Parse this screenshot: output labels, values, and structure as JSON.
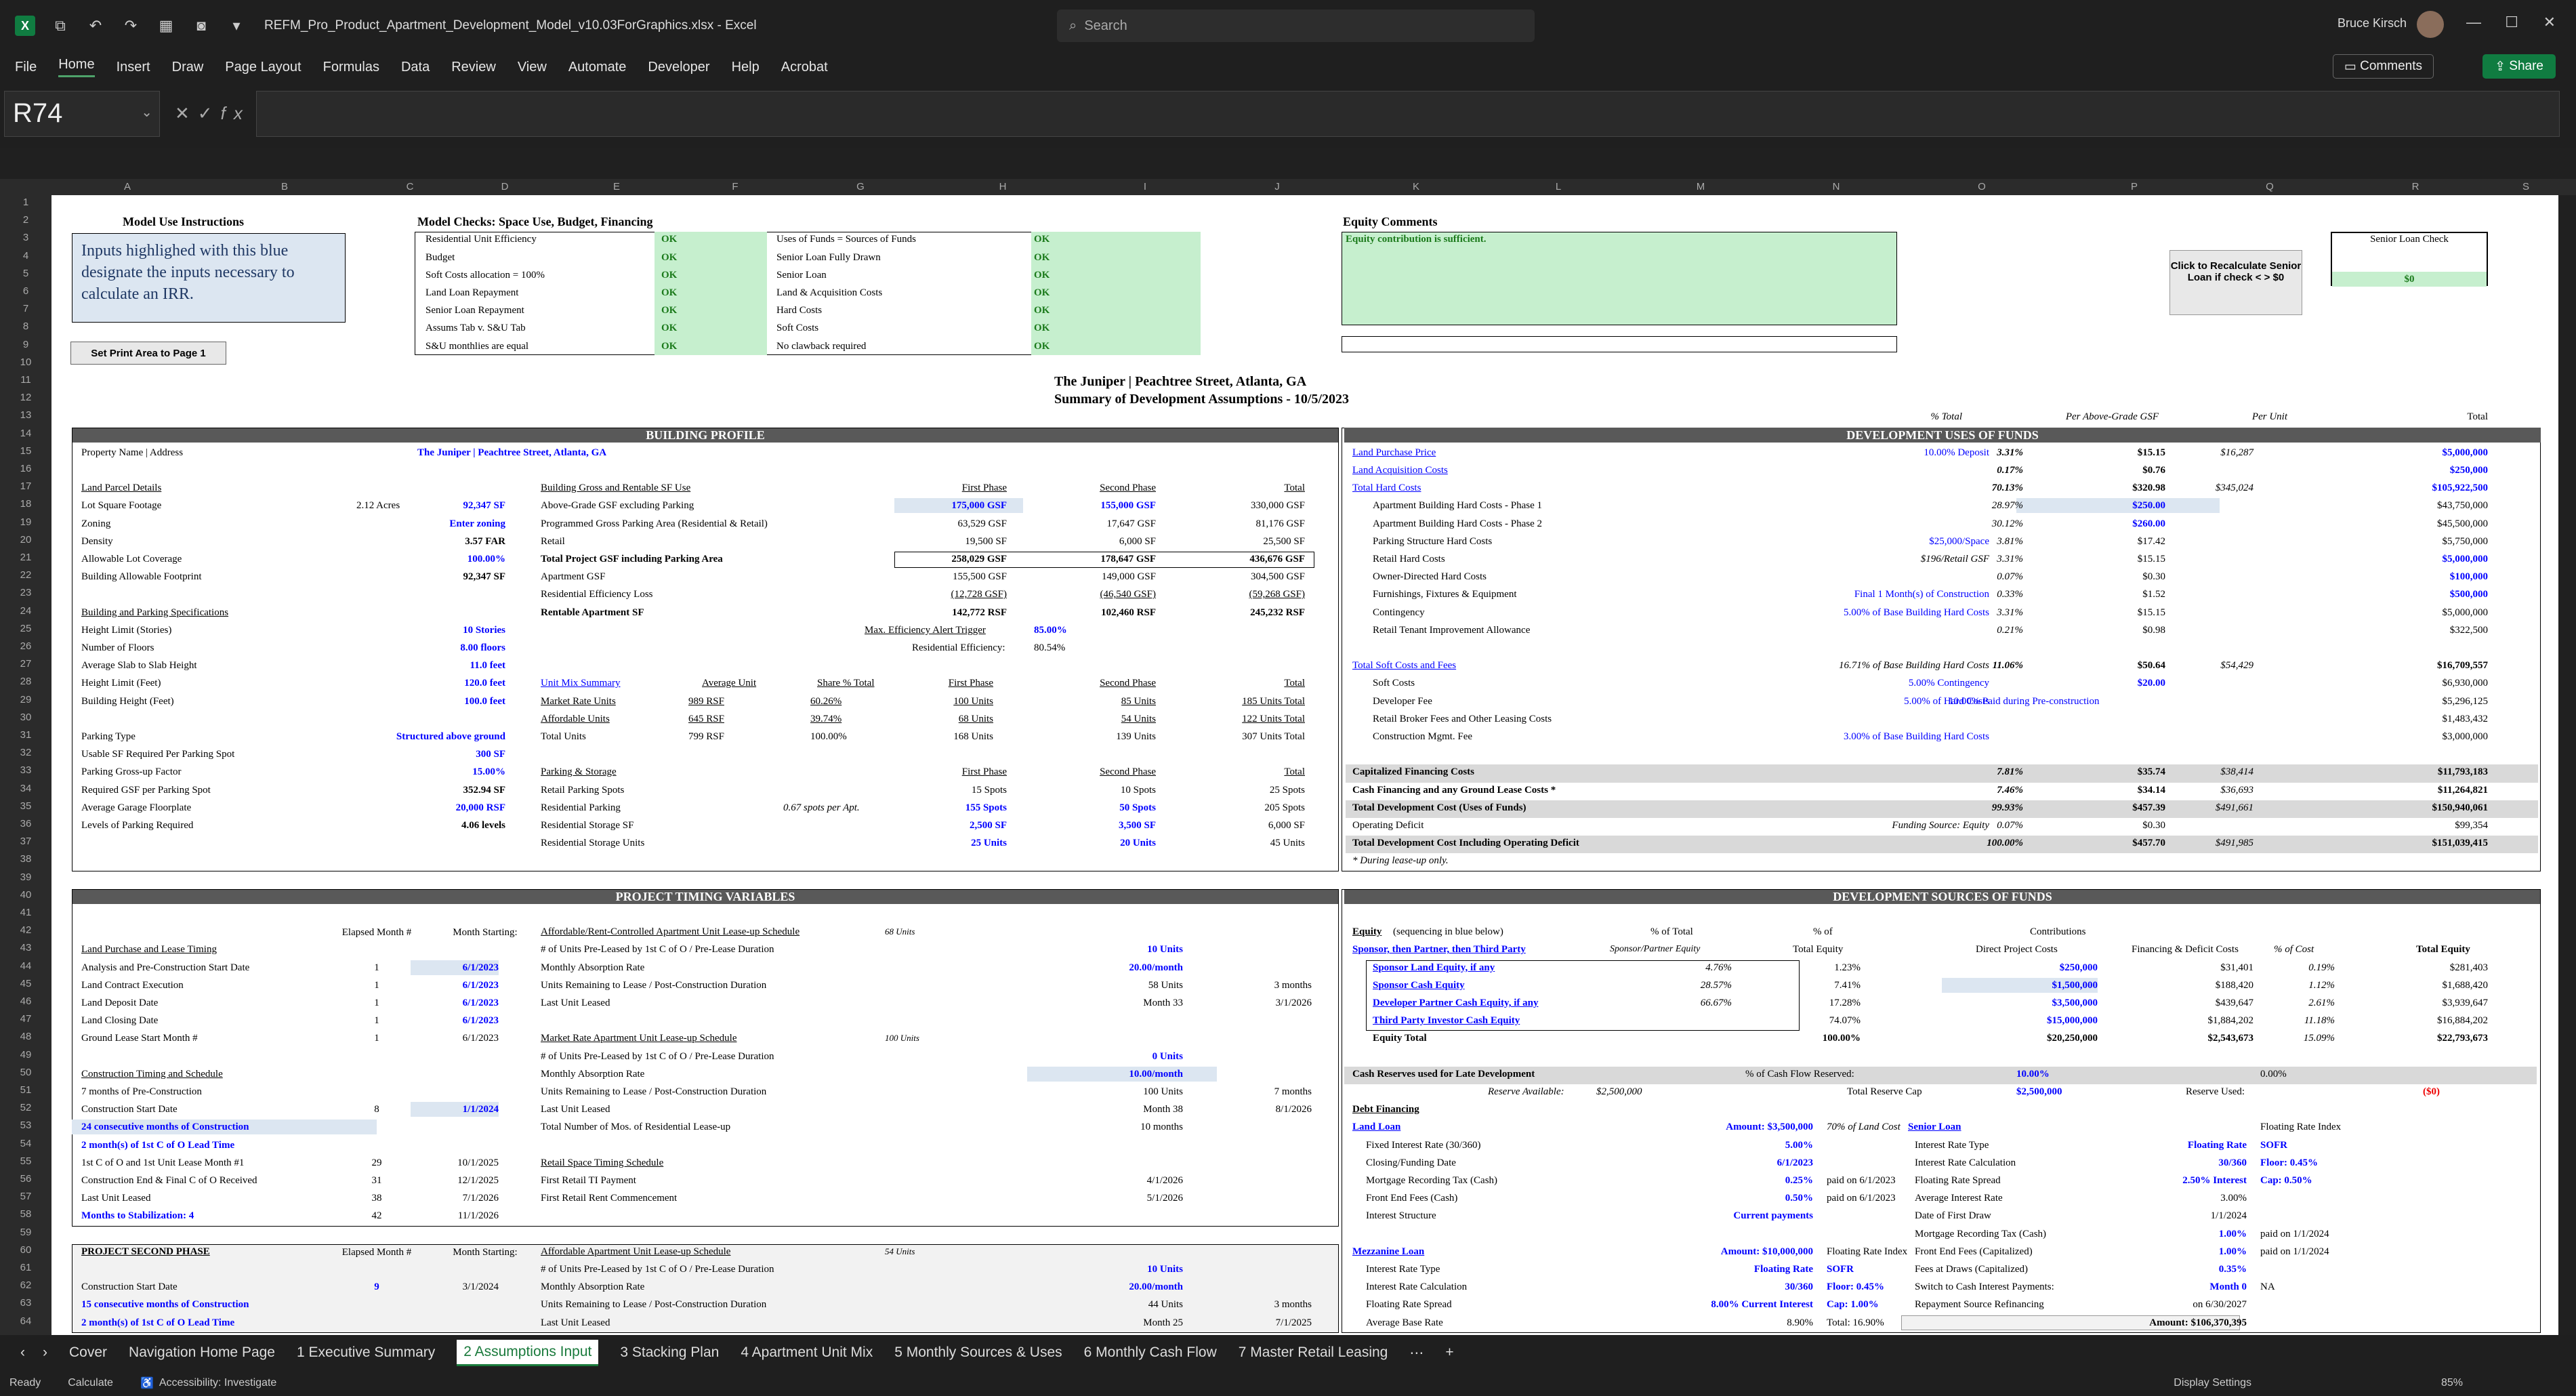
{
  "app": {
    "filename": "REFM_Pro_Product_Apartment_Development_Model_v10.03ForGraphics.xlsx",
    "app_name": "Excel",
    "search_placeholder": "Search",
    "user": "Bruce Kirsch"
  },
  "menu": [
    "File",
    "Home",
    "Insert",
    "Draw",
    "Page Layout",
    "Formulas",
    "Data",
    "Review",
    "View",
    "Automate",
    "Developer",
    "Help",
    "Acrobat"
  ],
  "buttons": {
    "comments": "Comments",
    "share": "Share"
  },
  "namebox": "R74",
  "columns": [
    "A",
    "B",
    "C",
    "D",
    "E",
    "F",
    "G",
    "H",
    "I",
    "J",
    "K",
    "L",
    "M",
    "N",
    "O",
    "P",
    "Q",
    "R",
    "S"
  ],
  "rows": [
    "1",
    "2",
    "3",
    "4",
    "5",
    "6",
    "7",
    "8",
    "9",
    "10",
    "11",
    "12",
    "13",
    "14",
    "15",
    "16",
    "17",
    "18",
    "19",
    "20",
    "21",
    "22",
    "23",
    "24",
    "25",
    "26",
    "27",
    "28",
    "29",
    "30",
    "31",
    "32",
    "33",
    "34",
    "35",
    "36",
    "37",
    "38",
    "39",
    "40",
    "41",
    "42",
    "43",
    "44",
    "45",
    "46",
    "47",
    "48",
    "49",
    "50",
    "51",
    "52",
    "53",
    "54",
    "55",
    "56",
    "57",
    "58",
    "59",
    "60",
    "61",
    "62",
    "63",
    "64"
  ],
  "sheet": {
    "model_use": "Model Use Instructions",
    "instructions": "Inputs highlighed with this blue designate the inputs necessary to calculate an IRR.",
    "print_btn": "Set Print Area to Page 1",
    "checks_title": "Model Checks: Space Use, Budget, Financing",
    "checks_left": [
      "Residential Unit Efficiency",
      "Budget",
      "Soft Costs allocation = 100%",
      "Land Loan Repayment",
      "Senior Loan Repayment",
      "Assums Tab v. S&U Tab",
      "S&U monthlies are equal"
    ],
    "checks_right": [
      "Uses of Funds = Sources of Funds",
      "Senior Loan Fully Drawn",
      "Senior Loan",
      "Land & Acquisition Costs",
      "Hard Costs",
      "Soft Costs",
      "No clawback required"
    ],
    "ok": "OK",
    "equity_comments_title": "Equity Comments",
    "equity_comments": "Equity contribution is sufficient.",
    "recalc_btn": "Click to Recalculate Senior Loan if check < > $0",
    "senior_check_title": "Senior Loan Check",
    "senior_check_value": "$0",
    "title1": "The Juniper | Peachtree Street, Atlanta, GA",
    "title2": "Summary of Development Assumptions - 10/5/2023",
    "bp_header": "BUILDING PROFILE",
    "uses_header": "DEVELOPMENT USES OF FUNDS",
    "uses_colhdrs": [
      "% Total",
      "Per Above-Grade GSF",
      "Per Unit",
      "Total"
    ],
    "property_label": "Property Name | Address",
    "property_value": "The Juniper | Peachtree Street, Atlanta, GA",
    "bp_rows": [
      [
        "Land Parcel Details",
        "",
        ""
      ],
      [
        "Lot Square Footage",
        "2.12 Acres",
        "92,347 SF"
      ],
      [
        "Zoning",
        "",
        "Enter zoning"
      ],
      [
        "Density",
        "",
        "3.57 FAR"
      ],
      [
        "Allowable Lot Coverage",
        "",
        "100.00%"
      ],
      [
        "Building Allowable Footprint",
        "",
        "92,347 SF"
      ],
      [
        "",
        "",
        ""
      ],
      [
        "Building and Parking Specifications",
        "",
        ""
      ],
      [
        "Height Limit (Stories)",
        "",
        "10 Stories"
      ],
      [
        "Number of Floors",
        "",
        "8.00 floors"
      ],
      [
        "Average Slab to Slab Height",
        "",
        "11.0 feet"
      ],
      [
        "Height Limit (Feet)",
        "",
        "120.0 feet"
      ],
      [
        "Building Height (Feet)",
        "",
        "100.0 feet"
      ],
      [
        "",
        "",
        ""
      ],
      [
        "Parking Type",
        "",
        "Structured above ground"
      ],
      [
        "Usable SF Required Per Parking Spot",
        "",
        "300 SF"
      ],
      [
        "Parking Gross-up Factor",
        "",
        "15.00%"
      ],
      [
        "Required GSF per Parking Spot",
        "",
        "352.94 SF"
      ],
      [
        "Average Garage Floorplate",
        "",
        "20,000 RSF"
      ],
      [
        "Levels of Parking Required",
        "",
        "4.06 levels"
      ]
    ],
    "gsf_hdr": [
      "Building Gross and Rentable SF Use",
      "First Phase",
      "Second Phase",
      "Total"
    ],
    "gsf_rows": [
      [
        "Above-Grade GSF excluding Parking",
        "175,000 GSF",
        "155,000 GSF",
        "330,000 GSF"
      ],
      [
        "Programmed Gross Parking Area (Residential & Retail)",
        "63,529 GSF",
        "17,647 GSF",
        "81,176 GSF"
      ],
      [
        "Retail",
        "19,500 SF",
        "6,000 SF",
        "25,500 SF"
      ],
      [
        "Total Project GSF including Parking Area",
        "258,029 GSF",
        "178,647 GSF",
        "436,676 GSF"
      ],
      [
        "Apartment GSF",
        "155,500 GSF",
        "149,000 GSF",
        "304,500 GSF"
      ],
      [
        "Residential Efficiency Loss",
        "(12,728 GSF)",
        "(46,540 GSF)",
        "(59,268 GSF)"
      ],
      [
        "Rentable Apartment SF",
        "142,772 RSF",
        "102,460 RSF",
        "245,232 RSF"
      ]
    ],
    "eff_trigger": "Max. Efficiency Alert Trigger",
    "eff_trigger_val": "85.00%",
    "res_eff": "Residential Efficiency:",
    "res_eff_val": "80.54%",
    "mix_hdr": [
      "Unit Mix Summary",
      "Average Unit",
      "Share % Total",
      "First Phase",
      "Second Phase",
      "Total"
    ],
    "mix_rows": [
      [
        "Market Rate Units",
        "989 RSF",
        "60.26%",
        "100 Units",
        "85 Units",
        "185 Units Total"
      ],
      [
        "Affordable Units",
        "645 RSF",
        "39.74%",
        "68 Units",
        "54 Units",
        "122 Units Total"
      ],
      [
        "Total Units",
        "799 RSF",
        "100.00%",
        "168 Units",
        "139 Units",
        "307 Units Total"
      ]
    ],
    "park_hdr": [
      "Parking & Storage",
      "First Phase",
      "Second Phase",
      "Total"
    ],
    "park_rows": [
      [
        "Retail Parking Spots",
        "",
        "15 Spots",
        "10 Spots",
        "25 Spots"
      ],
      [
        "Residential Parking",
        "0.67 spots per Apt.",
        "155 Spots",
        "50 Spots",
        "205 Spots"
      ],
      [
        "Residential Storage SF",
        "",
        "2,500 SF",
        "3,500 SF",
        "6,000 SF"
      ],
      [
        "Residential Storage Units",
        "",
        "25 Units",
        "20 Units",
        "45 Units"
      ]
    ],
    "uses_rows": [
      [
        "Land Purchase Price",
        "10.00% Deposit",
        "3.31%",
        "$15.15",
        "$16,287",
        "$5,000,000"
      ],
      [
        "Land Acquisition Costs",
        "",
        "0.17%",
        "$0.76",
        "",
        "$250,000"
      ],
      [
        "Total Hard Costs",
        "",
        "70.13%",
        "$320.98",
        "$345,024",
        "$105,922,500"
      ],
      [
        "Apartment Building Hard Costs - Phase 1",
        "",
        "28.97%",
        "$250.00",
        "",
        "$43,750,000"
      ],
      [
        "Apartment Building Hard Costs - Phase 2",
        "",
        "30.12%",
        "$260.00",
        "",
        "$45,500,000"
      ],
      [
        "Parking Structure Hard Costs",
        "$25,000/Space",
        "3.81%",
        "$17.42",
        "",
        "$5,750,000"
      ],
      [
        "Retail Hard Costs",
        "$196/Retail GSF",
        "3.31%",
        "$15.15",
        "",
        "$5,000,000"
      ],
      [
        "Owner-Directed Hard Costs",
        "",
        "0.07%",
        "$0.30",
        "",
        "$100,000"
      ],
      [
        "Furnishings, Fixtures & Equipment",
        "Final 1 Month(s) of Construction",
        "0.33%",
        "$1.52",
        "",
        "$500,000"
      ],
      [
        "Contingency",
        "5.00% of Base Building Hard Costs",
        "3.31%",
        "$15.15",
        "",
        "$5,000,000"
      ],
      [
        "Retail Tenant Improvement Allowance",
        "",
        "0.21%",
        "$0.98",
        "",
        "$322,500"
      ],
      [
        "",
        "",
        "",
        "",
        "",
        ""
      ],
      [
        "Total Soft Costs and Fees",
        "16.71% of Base Building Hard Costs",
        "11.06%",
        "$50.64",
        "$54,429",
        "$16,709,557"
      ],
      [
        "Soft Costs",
        "5.00% Contingency",
        "",
        "$20.00",
        "",
        "$6,930,000"
      ],
      [
        "Developer Fee",
        "5.00% of Hard Costs",
        "10.00% Paid during Pre-construction",
        "",
        "",
        "$5,296,125"
      ],
      [
        "Retail Broker Fees and Other Leasing Costs",
        "",
        "",
        "",
        "",
        "$1,483,432"
      ],
      [
        "Construction Mgmt. Fee",
        "3.00% of Base Building Hard Costs",
        "",
        "",
        "",
        "$3,000,000"
      ],
      [
        "",
        "",
        "",
        "",
        "",
        ""
      ],
      [
        "Capitalized Financing Costs",
        "",
        "7.81%",
        "$35.74",
        "$38,414",
        "$11,793,183"
      ],
      [
        "Cash Financing and any Ground Lease Costs *",
        "",
        "7.46%",
        "$34.14",
        "$36,693",
        "$11,264,821"
      ],
      [
        "Total Development Cost (Uses of Funds)",
        "",
        "99.93%",
        "$457.39",
        "$491,661",
        "$150,940,061"
      ],
      [
        "Operating Deficit",
        "Funding Source:   Equity",
        "0.07%",
        "$0.30",
        "",
        "$99,354"
      ],
      [
        "Total Development Cost Including Operating Deficit",
        "",
        "100.00%",
        "$457.70",
        "$491,985",
        "$151,039,415"
      ]
    ],
    "uses_note": "* During lease-up only.",
    "timing_header": "PROJECT TIMING VARIABLES",
    "timing_colhdr": [
      "Elapsed Month #",
      "Month Starting:"
    ],
    "timing_rows": [
      [
        "Land Purchase and Lease Timing",
        "",
        ""
      ],
      [
        "Analysis and Pre-Construction Start Date",
        "1",
        "6/1/2023"
      ],
      [
        "Land Contract Execution",
        "1",
        "6/1/2023"
      ],
      [
        "Land Deposit Date",
        "1",
        "6/1/2023"
      ],
      [
        "Land Closing Date",
        "1",
        "6/1/2023"
      ],
      [
        "Ground Lease Start Month #",
        "1",
        "6/1/2023"
      ],
      [
        "",
        "",
        ""
      ],
      [
        "Construction Timing and Schedule",
        "",
        ""
      ],
      [
        "7 months of Pre-Construction",
        "",
        ""
      ],
      [
        "Construction Start Date",
        "8",
        "1/1/2024"
      ],
      [
        "24 consecutive months of Construction",
        "",
        ""
      ],
      [
        "2 month(s) of 1st C of O Lead Time",
        "",
        ""
      ],
      [
        "1st C of O and 1st Unit Lease Month #1",
        "29",
        "10/1/2025"
      ],
      [
        "Construction End & Final C of O Received",
        "31",
        "12/1/2025"
      ],
      [
        "Last Unit Leased",
        "38",
        "7/1/2026"
      ],
      [
        "Months to Stabilization: 4",
        "42",
        "11/1/2026"
      ]
    ],
    "lease_rows": [
      [
        "Affordable/Rent-Controlled Apartment Unit Lease-up Schedule",
        "68 Units",
        "",
        ""
      ],
      [
        "# of Units Pre-Leased by 1st C of O / Pre-Lease Duration",
        "",
        "10 Units",
        ""
      ],
      [
        "Monthly Absorption Rate",
        "",
        "20.00/month",
        ""
      ],
      [
        "Units Remaining to Lease / Post-Construction Duration",
        "",
        "58 Units",
        "3 months"
      ],
      [
        "Last Unit Leased",
        "",
        "Month 33",
        "3/1/2026"
      ],
      [
        "",
        "",
        "",
        ""
      ],
      [
        "Market Rate Apartment Unit Lease-up Schedule",
        "100 Units",
        "",
        ""
      ],
      [
        "# of Units Pre-Leased by 1st C of O / Pre-Lease Duration",
        "",
        "0 Units",
        ""
      ],
      [
        "Monthly Absorption Rate",
        "",
        "10.00/month",
        ""
      ],
      [
        "Units Remaining to Lease / Post-Construction Duration",
        "",
        "100 Units",
        "7 months"
      ],
      [
        "Last Unit Leased",
        "",
        "Month 38",
        "8/1/2026"
      ],
      [
        "Total Number of Mos. of Residential Lease-up",
        "",
        "10 months",
        ""
      ],
      [
        "",
        "",
        "",
        ""
      ],
      [
        "Retail Space Timing Schedule",
        "",
        "",
        ""
      ],
      [
        "First Retail TI Payment",
        "",
        "4/1/2026",
        ""
      ],
      [
        "First Retail Rent Commencement",
        "",
        "5/1/2026",
        ""
      ]
    ],
    "phase2_title": "PROJECT SECOND PHASE",
    "phase2_rows": [
      [
        "Construction Start Date",
        "9",
        "3/1/2024"
      ],
      [
        "15 consecutive months of Construction",
        "",
        ""
      ],
      [
        "2 month(s) of 1st C of O Lead Time",
        "",
        ""
      ]
    ],
    "phase2_lease": [
      [
        "Affordable Apartment Unit Lease-up Schedule",
        "54 Units",
        "",
        ""
      ],
      [
        "# of Units Pre-Leased by 1st C of O / Pre-Lease Duration",
        "",
        "10 Units",
        ""
      ],
      [
        "Monthly Absorption Rate",
        "",
        "20.00/month",
        ""
      ],
      [
        "Units Remaining to Lease / Post-Construction Duration",
        "",
        "44 Units",
        "3 months"
      ],
      [
        "Last Unit Leased",
        "",
        "Month 25",
        "7/1/2025"
      ]
    ],
    "sources_header": "DEVELOPMENT SOURCES OF FUNDS",
    "sources_hdr": [
      "Equity",
      "(sequencing in blue below)",
      "% of Total",
      "% of",
      "Contributions",
      "Direct Project Costs",
      "Financing & Deficit Costs",
      "% of Cost",
      "Total Equity"
    ],
    "sources_sub": [
      "Sponsor, then Partner, then Third Party",
      "Sponsor/Partner Equity",
      "Total Equity"
    ],
    "sources_rows": [
      [
        "Sponsor Land Equity, if any",
        "4.76%",
        "1.23%",
        "$250,000",
        "$31,401",
        "0.19%",
        "$281,403"
      ],
      [
        "Sponsor Cash Equity",
        "28.57%",
        "7.41%",
        "$1,500,000",
        "$188,420",
        "1.12%",
        "$1,688,420"
      ],
      [
        "Developer Partner Cash Equity, if any",
        "66.67%",
        "17.28%",
        "$3,500,000",
        "$439,647",
        "2.61%",
        "$3,939,647"
      ],
      [
        "Third Party Investor Cash Equity",
        "",
        "74.07%",
        "$15,000,000",
        "$1,884,202",
        "11.18%",
        "$16,884,202"
      ],
      [
        "Equity Total",
        "",
        "100.00%",
        "$20,250,000",
        "$2,543,673",
        "15.09%",
        "$22,793,673"
      ]
    ],
    "reserves": [
      "Cash Reserves used for Late Development",
      "% of Cash Flow Reserved:",
      "10.00%",
      "0.00%",
      "Reserve Available:",
      "$2,500,000",
      "Total Reserve Cap",
      "$2,500,000",
      "Reserve Used:",
      "($0)"
    ],
    "debt_title": "Debt Financing",
    "land_loan": [
      [
        "Land Loan",
        "Amount: $3,500,000",
        "70% of Land Cost"
      ],
      [
        "Fixed Interest Rate (30/360)",
        "5.00%",
        ""
      ],
      [
        "Closing/Funding Date",
        "6/1/2023",
        ""
      ],
      [
        "Mortgage Recording Tax (Cash)",
        "0.25%",
        "paid on 6/1/2023"
      ],
      [
        "Front End Fees (Cash)",
        "0.50%",
        "paid on 6/1/2023"
      ],
      [
        "Interest Structure",
        "Current payments",
        ""
      ]
    ],
    "mezz_loan": [
      [
        "Mezzanine Loan",
        "Amount: $10,000,000",
        "Floating Rate Index"
      ],
      [
        "Interest Rate Type",
        "Floating Rate",
        "SOFR"
      ],
      [
        "Interest Rate Calculation",
        "30/360",
        "Floor: 0.45%"
      ],
      [
        "Floating Rate Spread",
        "8.00% Current Interest",
        "Cap: 1.00%"
      ],
      [
        "Average Base Rate",
        "8.90%",
        "Total: 16.90%"
      ]
    ],
    "senior_loan": [
      [
        "Senior Loan",
        "",
        "Floating Rate Index"
      ],
      [
        "Interest Rate Type",
        "Floating Rate",
        "SOFR"
      ],
      [
        "Interest Rate Calculation",
        "30/360",
        "Floor: 0.45%"
      ],
      [
        "Floating Rate Spread",
        "2.50% Interest",
        "Cap: 0.50%"
      ],
      [
        "Average Interest Rate",
        "3.00%",
        ""
      ],
      [
        "Date of First Draw",
        "1/1/2024",
        ""
      ],
      [
        "Mortgage Recording Tax (Cash)",
        "1.00%",
        "paid on 1/1/2024"
      ],
      [
        "Front End Fees (Capitalized)",
        "1.00%",
        "paid on 1/1/2024"
      ],
      [
        "Fees at Draws (Capitalized)",
        "0.35%",
        ""
      ],
      [
        "Switch to Cash Interest Payments:",
        "Month 0",
        "NA"
      ],
      [
        "Repayment Source   Refinancing",
        "on 6/30/2027",
        ""
      ],
      [
        "",
        "Amount: $106,370,395",
        ""
      ]
    ]
  },
  "tabs": [
    "Cover",
    "Navigation Home Page",
    "1 Executive Summary",
    "2 Assumptions Input",
    "3 Stacking Plan",
    "4 Apartment Unit Mix",
    "5 Monthly Sources & Uses",
    "6 Monthly Cash Flow",
    "7 Master Retail Leasing"
  ],
  "status": {
    "ready": "Ready",
    "calculate": "Calculate",
    "accessibility": "Accessibility: Investigate",
    "display": "Display Settings",
    "zoom": "85%"
  }
}
